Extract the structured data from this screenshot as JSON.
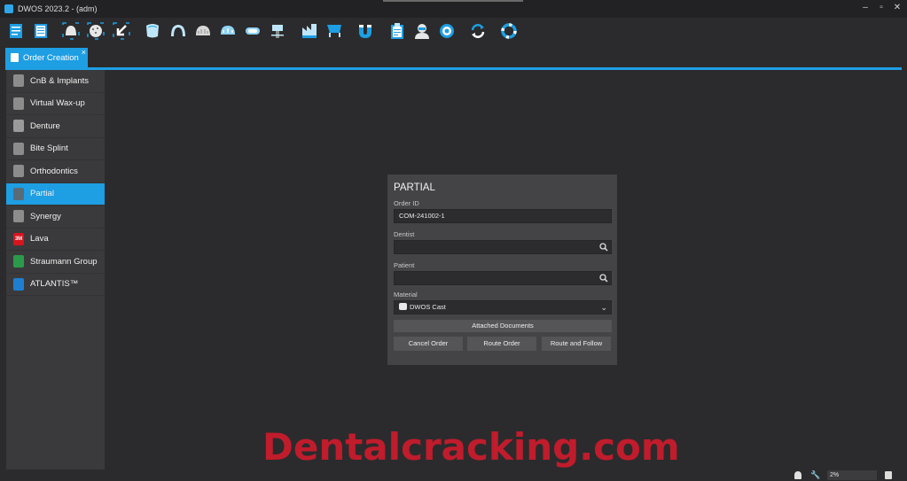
{
  "window": {
    "title": "DWOS 2023.2 - (adm)",
    "minimize": "–",
    "restore": "▫",
    "close": "✕"
  },
  "toolbar": {
    "icons": [
      "order-form-icon",
      "order-list-icon",
      "scan-upper-icon",
      "scan-dots-icon",
      "import-arrow-icon",
      "crown-icon",
      "bridge-icon",
      "denture-icon",
      "bite-icon",
      "splint-icon",
      "implant-icon",
      "model-icon",
      "cart-icon",
      "magnet-icon",
      "clipboard-icon",
      "technician-icon",
      "settings-gear-icon",
      "refresh-icon",
      "help-ring-icon"
    ]
  },
  "tabs": [
    {
      "label": "Order Creation",
      "close": "×"
    }
  ],
  "sidebar": {
    "items": [
      {
        "label": "CnB & Implants",
        "icon": "cnb-implants-icon",
        "active": false
      },
      {
        "label": "Virtual Wax-up",
        "icon": "wax-up-icon",
        "active": false
      },
      {
        "label": "Denture",
        "icon": "denture-icon",
        "active": false
      },
      {
        "label": "Bite Splint",
        "icon": "bite-splint-icon",
        "active": false
      },
      {
        "label": "Orthodontics",
        "icon": "orthodontics-icon",
        "active": false
      },
      {
        "label": "Partial",
        "icon": "partial-icon",
        "active": true
      },
      {
        "label": "Synergy",
        "icon": "synergy-icon",
        "active": false
      },
      {
        "label": "Lava",
        "icon": "3m-lava-icon",
        "active": false,
        "icon_text": "3M"
      },
      {
        "label": "Straumann Group",
        "icon": "straumann-icon",
        "active": false
      },
      {
        "label": "ATLANTIS™",
        "icon": "atlantis-icon",
        "active": false
      }
    ]
  },
  "panel": {
    "title": "PARTIAL",
    "order_id_label": "Order ID",
    "order_id_value": "COM-241002-1",
    "dentist_label": "Dentist",
    "dentist_value": "",
    "patient_label": "Patient",
    "patient_value": "",
    "material_label": "Material",
    "material_value": "DWOS Cast",
    "attached_documents": "Attached Documents",
    "cancel_order": "Cancel Order",
    "route_order": "Route Order",
    "route_and_follow": "Route and Follow"
  },
  "watermark": "Dentalcracking.com",
  "status": {
    "zoom": "2%"
  },
  "colors": {
    "accent": "#1e9ee3",
    "background": "#2b2b2d",
    "sidebar": "#3a3a3c",
    "panel": "#444446",
    "watermark": "#c01c2c"
  }
}
